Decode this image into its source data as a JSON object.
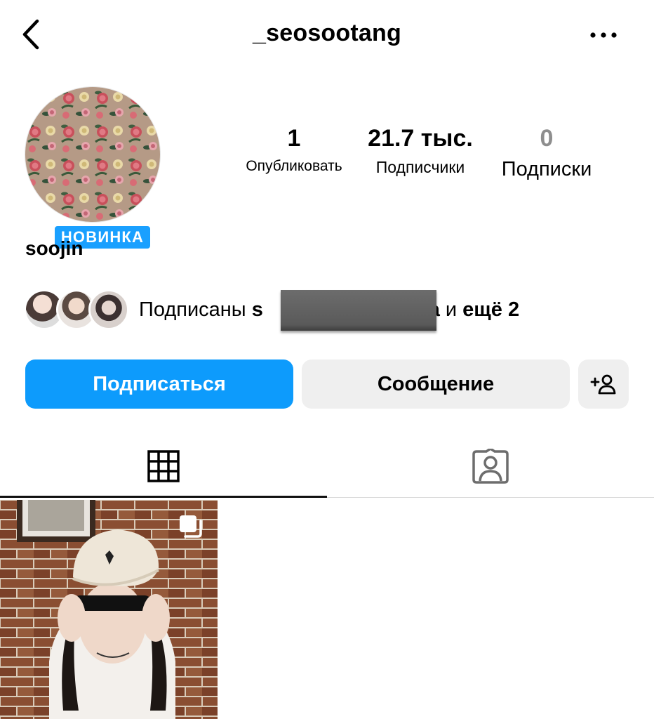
{
  "header": {
    "username": "_seosootang",
    "back_icon": "chevron-left-icon",
    "more_icon": "more-horizontal-icon"
  },
  "profile": {
    "badge": "НОВИНКА",
    "display_name": "soojin"
  },
  "stats": [
    {
      "value": "1",
      "label": "Опубликовать"
    },
    {
      "value": "21.7 тыс.",
      "label": "Подписчики"
    },
    {
      "value": "0",
      "label": "Подписки"
    }
  ],
  "followed_by": {
    "prefix": "Подписаны ",
    "name_start": "s",
    "name_end": "ova",
    "middle": " и ",
    "suffix": "ещё 2"
  },
  "actions": {
    "follow_label": "Подписаться",
    "message_label": "Сообщение",
    "add_icon": "add-person-icon"
  },
  "tabs": [
    {
      "icon": "grid-icon",
      "active": true
    },
    {
      "icon": "tagged-person-icon",
      "active": false
    }
  ],
  "colors": {
    "accent": "#0d9bfc",
    "badge": "#1aa0ff",
    "button_secondary": "#efefef",
    "muted_text": "#8e8e8e"
  }
}
